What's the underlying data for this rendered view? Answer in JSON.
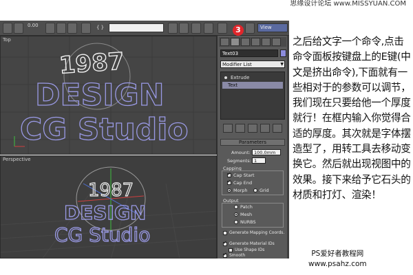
{
  "watermark": {
    "top": "思缘设计论坛 www.MISSYUAN.COM",
    "bottom_line1": "PS爱好者教程网",
    "bottom_line2": "www.psahz.com"
  },
  "toolbar": {
    "zoom_value": "0.00",
    "selection_set": "",
    "view_select": "View",
    "step_badge": "3"
  },
  "viewports": {
    "top": {
      "label": "Top",
      "text": [
        "1987",
        "DESIGN",
        "CG Studio"
      ]
    },
    "perspective": {
      "label": "Perspective",
      "text": [
        "1987",
        "DESIGN",
        "CG Studio"
      ]
    }
  },
  "command_panel": {
    "object_name": "Text03",
    "object_color": "#8c8cdc",
    "modifier_list": "Modifier List",
    "stack": [
      "Extrude",
      "Text"
    ],
    "rollout_title": "Parameters",
    "amount_label": "Amount:",
    "amount_value": "100.0mm",
    "segments_label": "Segments:",
    "segments_value": "1",
    "capping_label": "Capping",
    "cap_start": "Cap Start",
    "cap_end": "Cap End",
    "morph": "Morph",
    "grid": "Grid",
    "output_label": "Output",
    "patch": "Patch",
    "mesh": "Mesh",
    "nurbs": "NURBS",
    "gen_mapping": "Generate Mapping Coords.",
    "gen_material": "Generate Material IDs",
    "use_shape_ids": "Use Shape IDs",
    "smooth": "Smooth"
  },
  "note_text": "之后给文字一个命令,点击命令面板按键盘上的E键(中文是挤出命令),下面就有一些相对于的参数可以调节，我们现在只要给他一个厚度就行！在框内输入你觉得合适的厚度。其次就是字体摆造型了，用转工具去移动变换它。然后就出现视图中的效果。接下来给予它石头的材质和打灯、渲染！",
  "colors": {
    "accent_badge": "#e0262b",
    "text_wire_white": "#f2f2f2",
    "text_wire_blue": "#9a9ae6"
  }
}
